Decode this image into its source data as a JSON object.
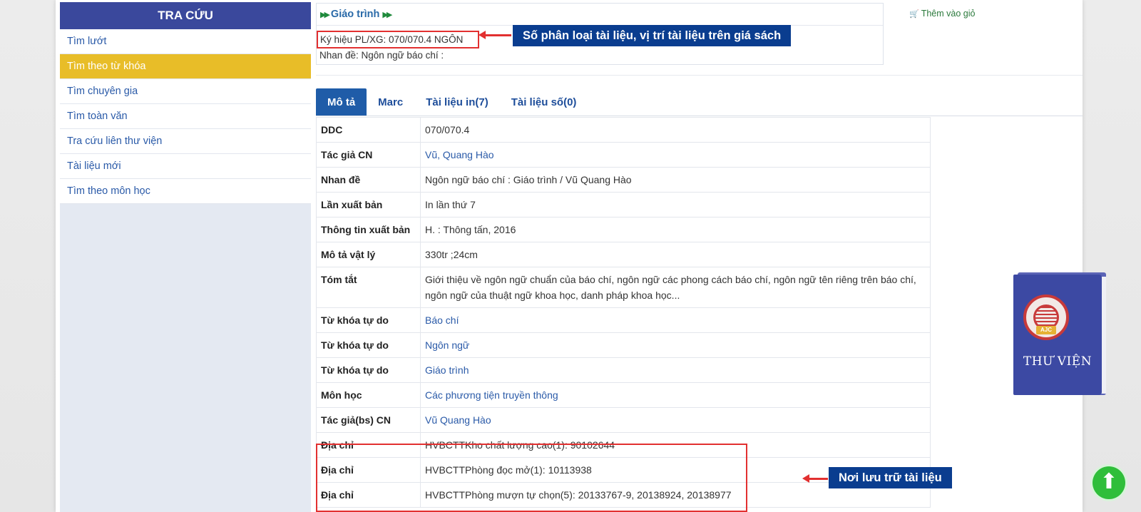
{
  "sidebar": {
    "title": "TRA CỨU",
    "items": [
      {
        "label": "Tìm lướt"
      },
      {
        "label": "Tìm theo từ khóa"
      },
      {
        "label": "Tìm chuyên gia"
      },
      {
        "label": "Tìm toàn văn"
      },
      {
        "label": "Tra cứu liên thư viện"
      },
      {
        "label": "Tài liệu mới"
      },
      {
        "label": "Tìm theo môn học"
      }
    ],
    "active_item": "Tìm theo từ khóa"
  },
  "record": {
    "category": "Giáo trình",
    "call_number": "Ký hiệu PL/XG: 070/070.4 NGÔN",
    "title_line": "Nhan đề: Ngôn ngữ báo chí :"
  },
  "cart": {
    "label": "Thêm vào giỏ"
  },
  "annotations": {
    "call_number_note": "Số phân loại tài liệu, vị trí tài liệu trên giá sách",
    "location_note": "Nơi lưu trữ tài liệu"
  },
  "tabs": [
    {
      "label": "Mô tả",
      "active": true
    },
    {
      "label": "Marc"
    },
    {
      "label": "Tài liệu in(7)"
    },
    {
      "label": "Tài liệu số(0)"
    }
  ],
  "table": {
    "rows": [
      {
        "key": "DDC",
        "value": "070/070.4"
      },
      {
        "key": "Tác giả CN",
        "value": "Vũ, Quang Hào",
        "link": true
      },
      {
        "key": "Nhan đề",
        "value": "Ngôn ngữ báo chí : Giáo trình / Vũ Quang Hào"
      },
      {
        "key": "Lần xuất bản",
        "value": "In lần thứ 7"
      },
      {
        "key": "Thông tin xuất bản",
        "value": "H. : Thông tấn, 2016"
      },
      {
        "key": "Mô tả vật lý",
        "value": "330tr ;24cm"
      },
      {
        "key": "Tóm tắt",
        "value": "Giới thiệu về ngôn ngữ chuẩn của báo chí, ngôn ngữ các phong cách báo chí, ngôn ngữ tên riêng trên báo chí, ngôn ngữ của thuật ngữ khoa học, danh pháp khoa học..."
      },
      {
        "key": "Từ khóa tự do",
        "value": "Báo chí",
        "link": true
      },
      {
        "key": "Từ khóa tự do",
        "value": "Ngôn ngữ",
        "link": true
      },
      {
        "key": "Từ khóa tự do",
        "value": "Giáo trình",
        "link": true
      },
      {
        "key": "Môn học",
        "value": "Các phương tiện truyền thông",
        "link": true
      },
      {
        "key": "Tác giả(bs) CN",
        "value": "Vũ Quang Hào",
        "link": true
      },
      {
        "key": "Địa chỉ",
        "value": "HVBCTTKho chất lượng cao(1): 90102644"
      },
      {
        "key": "Địa chỉ",
        "value": "HVBCTTPhòng đọc mở(1): 10113938"
      },
      {
        "key": "Địa chỉ",
        "value": "HVBCTTPhòng mượn tự chọn(5): 20133767-9, 20138924, 20138977"
      }
    ]
  },
  "book_cover": {
    "title": "THƯ VIỆN",
    "seal_text": "AJC"
  },
  "colors": {
    "sidebar_header": "#3a489c",
    "active_item": "#e8bd28",
    "link": "#2a5aa8",
    "annotation_red": "#e23030",
    "annotation_label_bg": "#0a3d8f",
    "scroll_top": "#2fbe3a"
  },
  "icons": {
    "cart": "cart-icon",
    "scroll_top": "arrow-up-icon",
    "category_arrows": "double-chevron-right-icon"
  }
}
